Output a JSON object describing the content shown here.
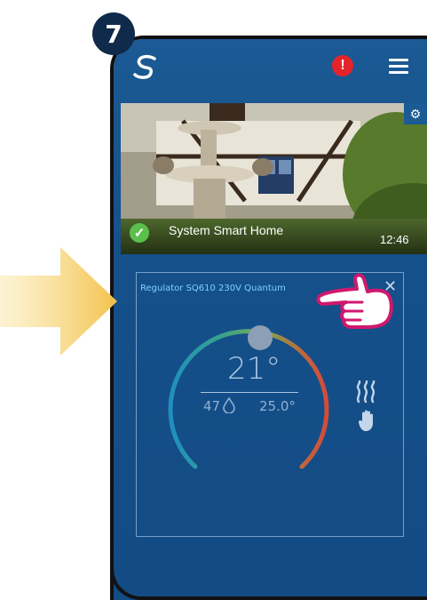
{
  "step": {
    "number": "7"
  },
  "header": {
    "logo_icon": "syxnc-logo-icon",
    "alert_symbol": "!",
    "menu_icon": "hamburger-menu-icon"
  },
  "home": {
    "name": "System Smart Home",
    "time": "12:46",
    "status_icon": "check-circle-icon",
    "settings_icon": "gear-icon"
  },
  "device": {
    "title": "Regulator SQ610 230V Quantum",
    "close_symbol": "✕",
    "temperature": "21°",
    "humidity": "47",
    "setpoint": "25.0°",
    "mode_icons": [
      "heating-waves-icon",
      "manual-hand-icon"
    ]
  },
  "colors": {
    "accent": "#1b5a94",
    "alert": "#e5232b",
    "arrow": "#f3c24a",
    "pointer": "#d0186e"
  }
}
